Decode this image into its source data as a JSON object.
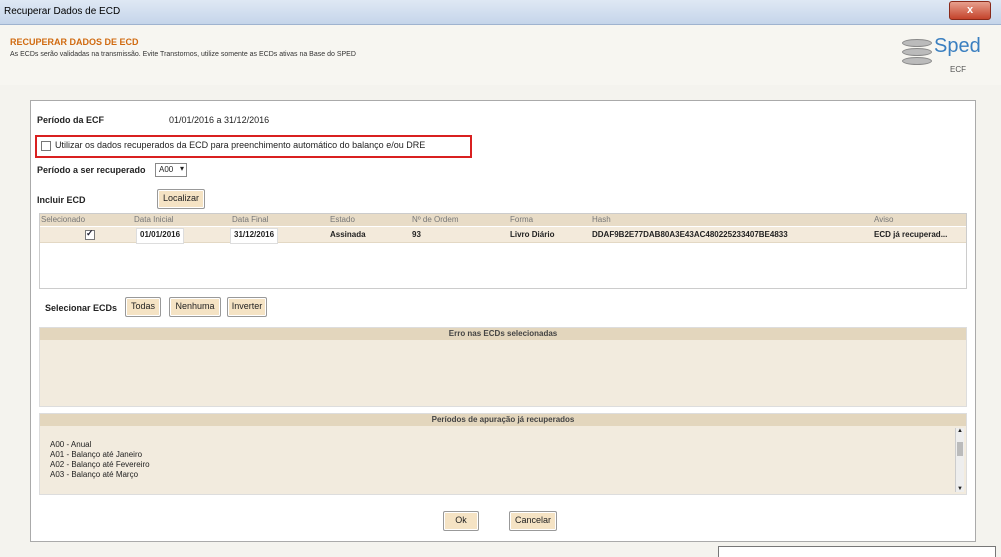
{
  "window": {
    "title": "Recuperar Dados de ECD",
    "close_label": "x"
  },
  "header": {
    "title": "RECUPERAR DADOS DE ECD",
    "subtitle": "As ECDs serão validadas na transmissão. Evite Transtornos, utilize somente as ECDs ativas na Base do SPED",
    "logo_word": "Sped",
    "logo_sub": "ECF"
  },
  "form": {
    "periodo_ecf_label": "Período da ECF",
    "periodo_ecf_value": "01/01/2016 a 31/12/2016",
    "checkbox_label": "Utilizar os dados recuperados da ECD para preenchimento automático do balanço e/ou DRE",
    "periodo_recuperado_label": "Período a ser recuperado",
    "periodo_recuperado_value": "A00",
    "incluir_label": "Incluir ECD",
    "localizar_label": "Localizar"
  },
  "table": {
    "headers": [
      "Selecionado",
      "Data Inicial",
      "Data Final",
      "Estado",
      "Nº de Ordem",
      "Forma",
      "Hash",
      "Aviso"
    ],
    "rows": [
      {
        "selecionado": true,
        "data_inicial": "01/01/2016",
        "data_final": "31/12/2016",
        "estado": "Assinada",
        "ordem": "93",
        "forma": "Livro Diário",
        "hash": "DDAF9B2E77DAB80A3E43AC480225233407BE4833",
        "aviso": "ECD já recuperad..."
      }
    ]
  },
  "select_buttons": {
    "label": "Selecionar ECDs",
    "todas": "Todas",
    "nenhuma": "Nenhuma",
    "inverter": "Inverter"
  },
  "errors_section": {
    "title": "Erro nas ECDs selecionadas"
  },
  "periods_section": {
    "title": "Períodos de apuração já recuperados",
    "items": [
      "A00 - Anual",
      "A01 - Balanço até Janeiro",
      "A02 - Balanço até Fevereiro",
      "A03 - Balanço até Março"
    ]
  },
  "footer": {
    "ok": "Ok",
    "cancel": "Cancelar"
  }
}
